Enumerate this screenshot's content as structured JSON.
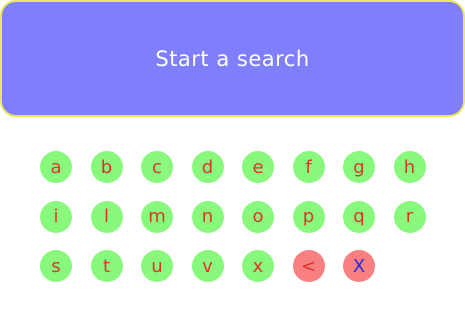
{
  "search": {
    "prompt": "Start a search"
  },
  "keyboard": {
    "rows": [
      [
        "a",
        "b",
        "c",
        "d",
        "e",
        "f",
        "g",
        "h"
      ],
      [
        "i",
        "l",
        "m",
        "n",
        "o",
        "p",
        "q",
        "r"
      ],
      [
        "s",
        "t",
        "u",
        "v",
        "x"
      ]
    ],
    "backspace_label": "<",
    "clear_label": "X"
  },
  "colors": {
    "banner_background": "#7f7ffe",
    "banner_border": "#e8e85a",
    "key_background": "#88f97c",
    "key_text": "#e0332a",
    "control_key_background": "#f98080",
    "clear_key_text": "#2b2bd8"
  }
}
